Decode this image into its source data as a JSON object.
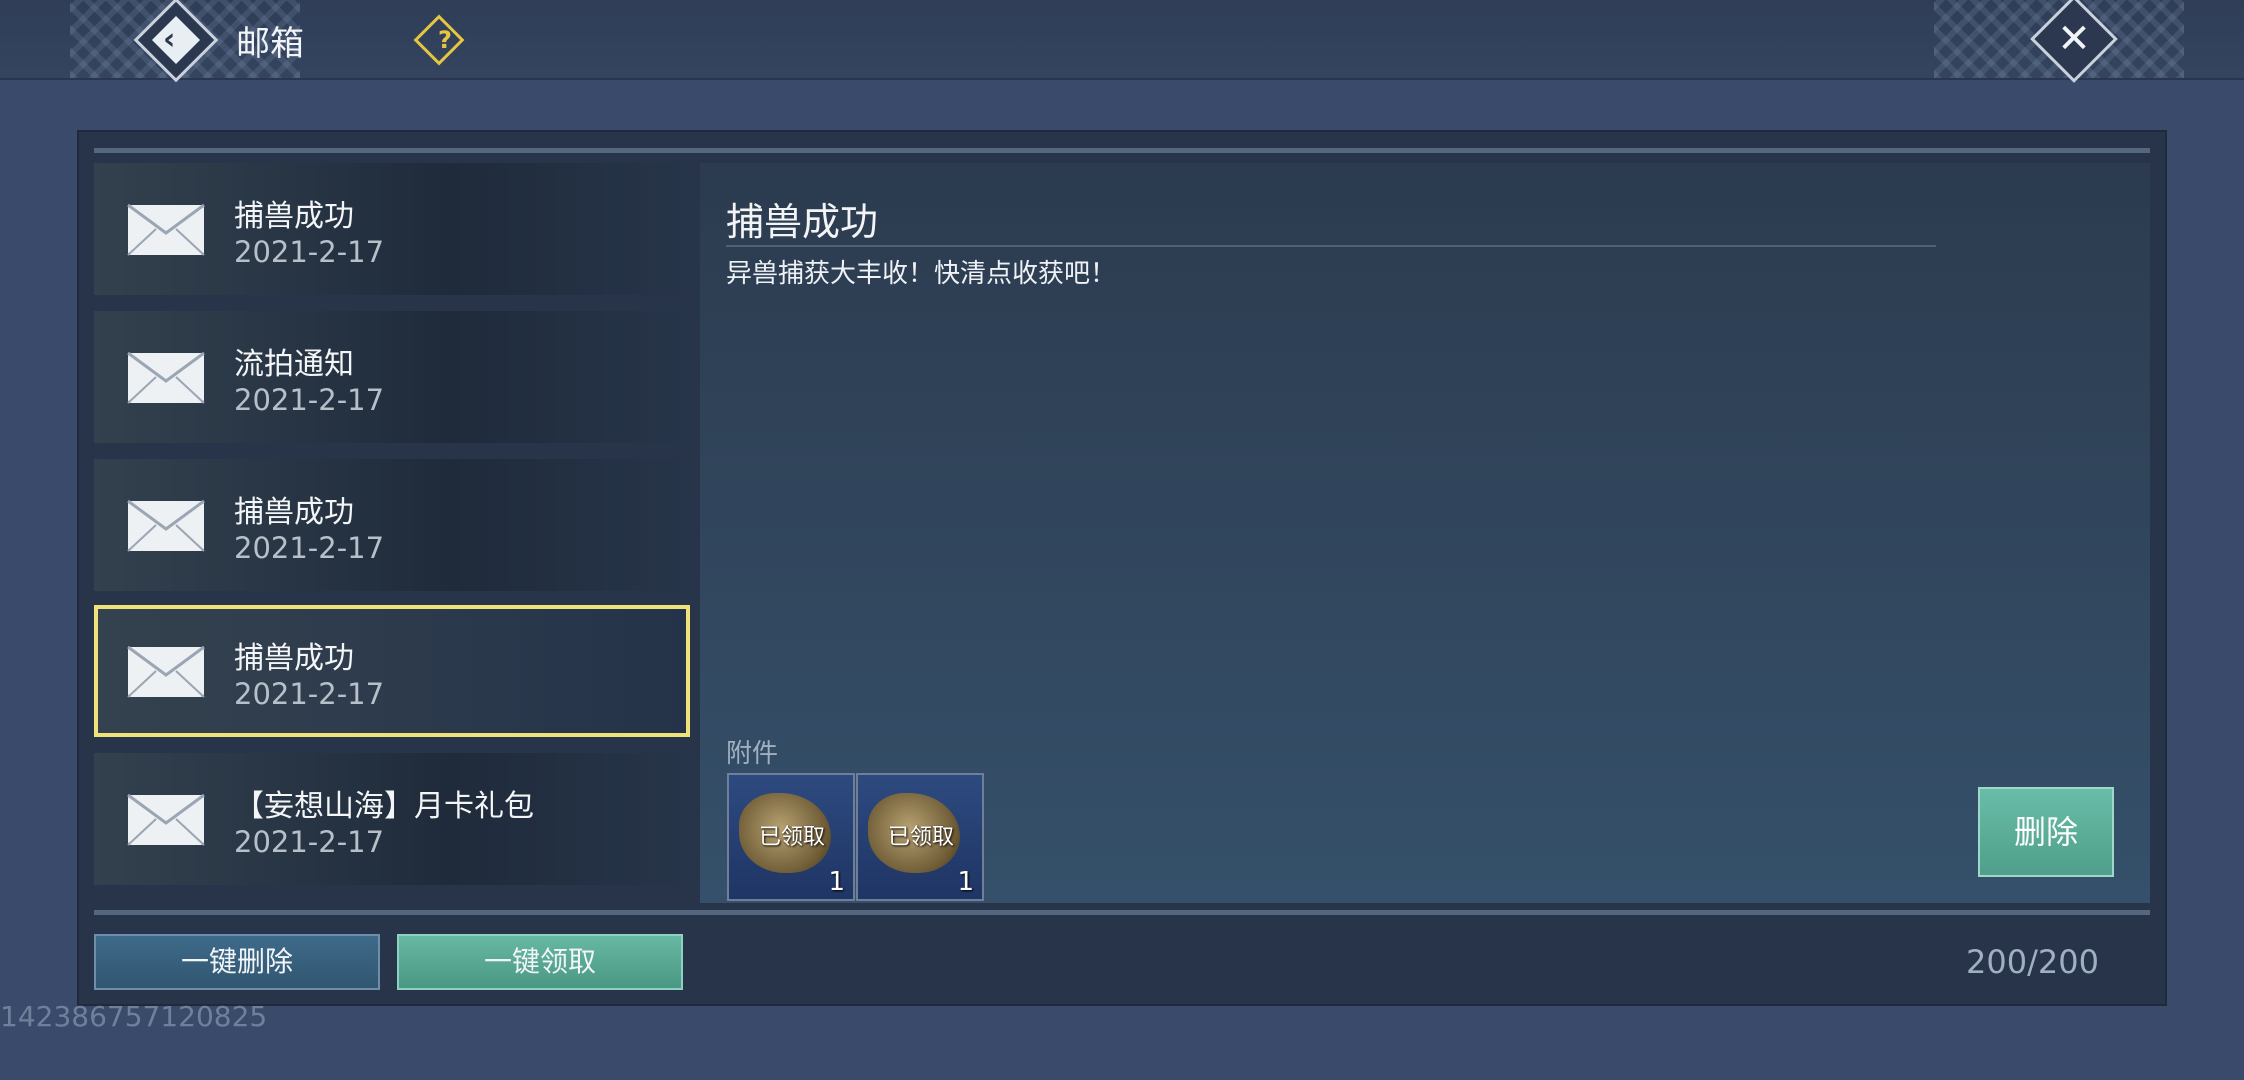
{
  "header": {
    "title": "邮箱",
    "help_symbol": "?"
  },
  "mails": [
    {
      "title": "捕兽成功",
      "date": "2021-2-17"
    },
    {
      "title": "流拍通知",
      "date": "2021-2-17"
    },
    {
      "title": "捕兽成功",
      "date": "2021-2-17"
    },
    {
      "title": "捕兽成功",
      "date": "2021-2-17"
    },
    {
      "title": "【妄想山海】月卡礼包",
      "date": "2021-2-17"
    }
  ],
  "selected_index": 3,
  "detail": {
    "title": "捕兽成功",
    "body": "异兽捕获大丰收！快清点收获吧！",
    "attachments_label": "附件",
    "attachments": [
      {
        "tag": "已领取",
        "qty": "1"
      },
      {
        "tag": "已领取",
        "qty": "1"
      }
    ],
    "delete_label": "删除"
  },
  "footer": {
    "delete_all_label": "一键删除",
    "claim_all_label": "一键领取",
    "counter": "200/200"
  },
  "uid": "142386757120825",
  "colors": {
    "selected_border": "#f0e27a",
    "accent_teal": "#5fae98",
    "help_yellow": "#e6c640"
  }
}
